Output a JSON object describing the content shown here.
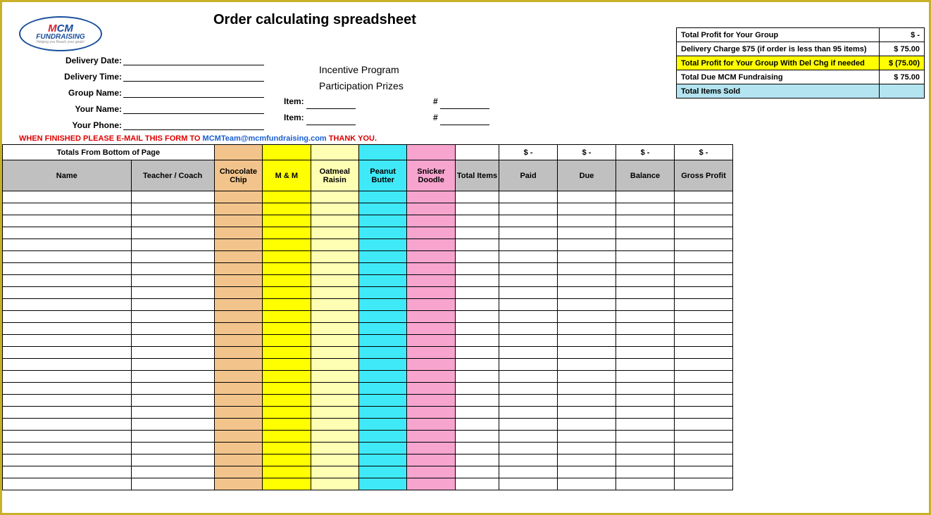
{
  "title": "Order calculating spreadsheet",
  "logo": {
    "line1a": "M",
    "line1b": "CM",
    "line2": "FUNDRAISING",
    "line3": "Helping you Reach your goals!"
  },
  "form": {
    "delivery_date": "Delivery Date:",
    "delivery_time": "Delivery Time:",
    "group_name": "Group Name:",
    "your_name": "Your Name:",
    "your_phone": "Your Phone:",
    "item": "Item:",
    "hash": "#"
  },
  "incentive": {
    "line1": "Incentive Program",
    "line2": "Participation Prizes"
  },
  "email": {
    "prefix": "WHEN FINISHED PLEASE E-MAIL THIS FORM TO ",
    "link": "MCMTeam@mcmfundraising.com",
    "suffix": "  THANK  YOU."
  },
  "summary": [
    {
      "label": "Total Profit for Your Group",
      "value": "$          -",
      "cls": ""
    },
    {
      "label": "Delivery Charge $75 (if order is less than 95 items)",
      "value": "$     75.00",
      "cls": ""
    },
    {
      "label": "Total Profit for Your Group With Del Chg if needed",
      "value": "$    (75.00)",
      "cls": "yellow"
    },
    {
      "label": "Total Due MCM Fundraising",
      "value": "$     75.00",
      "cls": ""
    },
    {
      "label": "Total Items Sold",
      "value": "",
      "cls": "lblue"
    }
  ],
  "totals_from_bottom": "Totals From Bottom of Page",
  "money_header": "$            -",
  "headers": {
    "name": "Name",
    "teacher": "Teacher / Coach",
    "choc": "Chocolate Chip",
    "mm": "M & M",
    "oat": "Oatmeal Raisin",
    "pb": "Peanut Butter",
    "snk": "Snicker Doodle",
    "total": "Total Items",
    "paid": "Paid",
    "due": "Due",
    "balance": "Balance",
    "profit": "Gross Profit"
  },
  "row_count": 25
}
